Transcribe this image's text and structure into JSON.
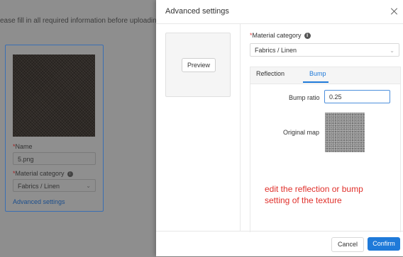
{
  "background": {
    "notice": "ease fill in all required information before uploading.",
    "card": {
      "name_label": "Name",
      "name_value": "5.png",
      "category_label": "Material category",
      "category_value": "Fabrics / Linen",
      "advanced_link": "Advanced settings"
    }
  },
  "modal": {
    "title": "Advanced settings",
    "preview_button": "Preview",
    "category_label": "Material category",
    "category_value": "Fabrics / Linen",
    "tabs": [
      {
        "label": "Reflection",
        "active": false
      },
      {
        "label": "Bump",
        "active": true
      }
    ],
    "bump_ratio_label": "Bump ratio",
    "bump_ratio_value": "0.25",
    "original_map_label": "Original map",
    "cancel_label": "Cancel",
    "confirm_label": "Confirm"
  },
  "annotation": "edit the reflection or bump setting of the texture",
  "colors": {
    "accent": "#1f7ad9",
    "annotation": "#e0302b",
    "required_star": "#e23c3c"
  }
}
